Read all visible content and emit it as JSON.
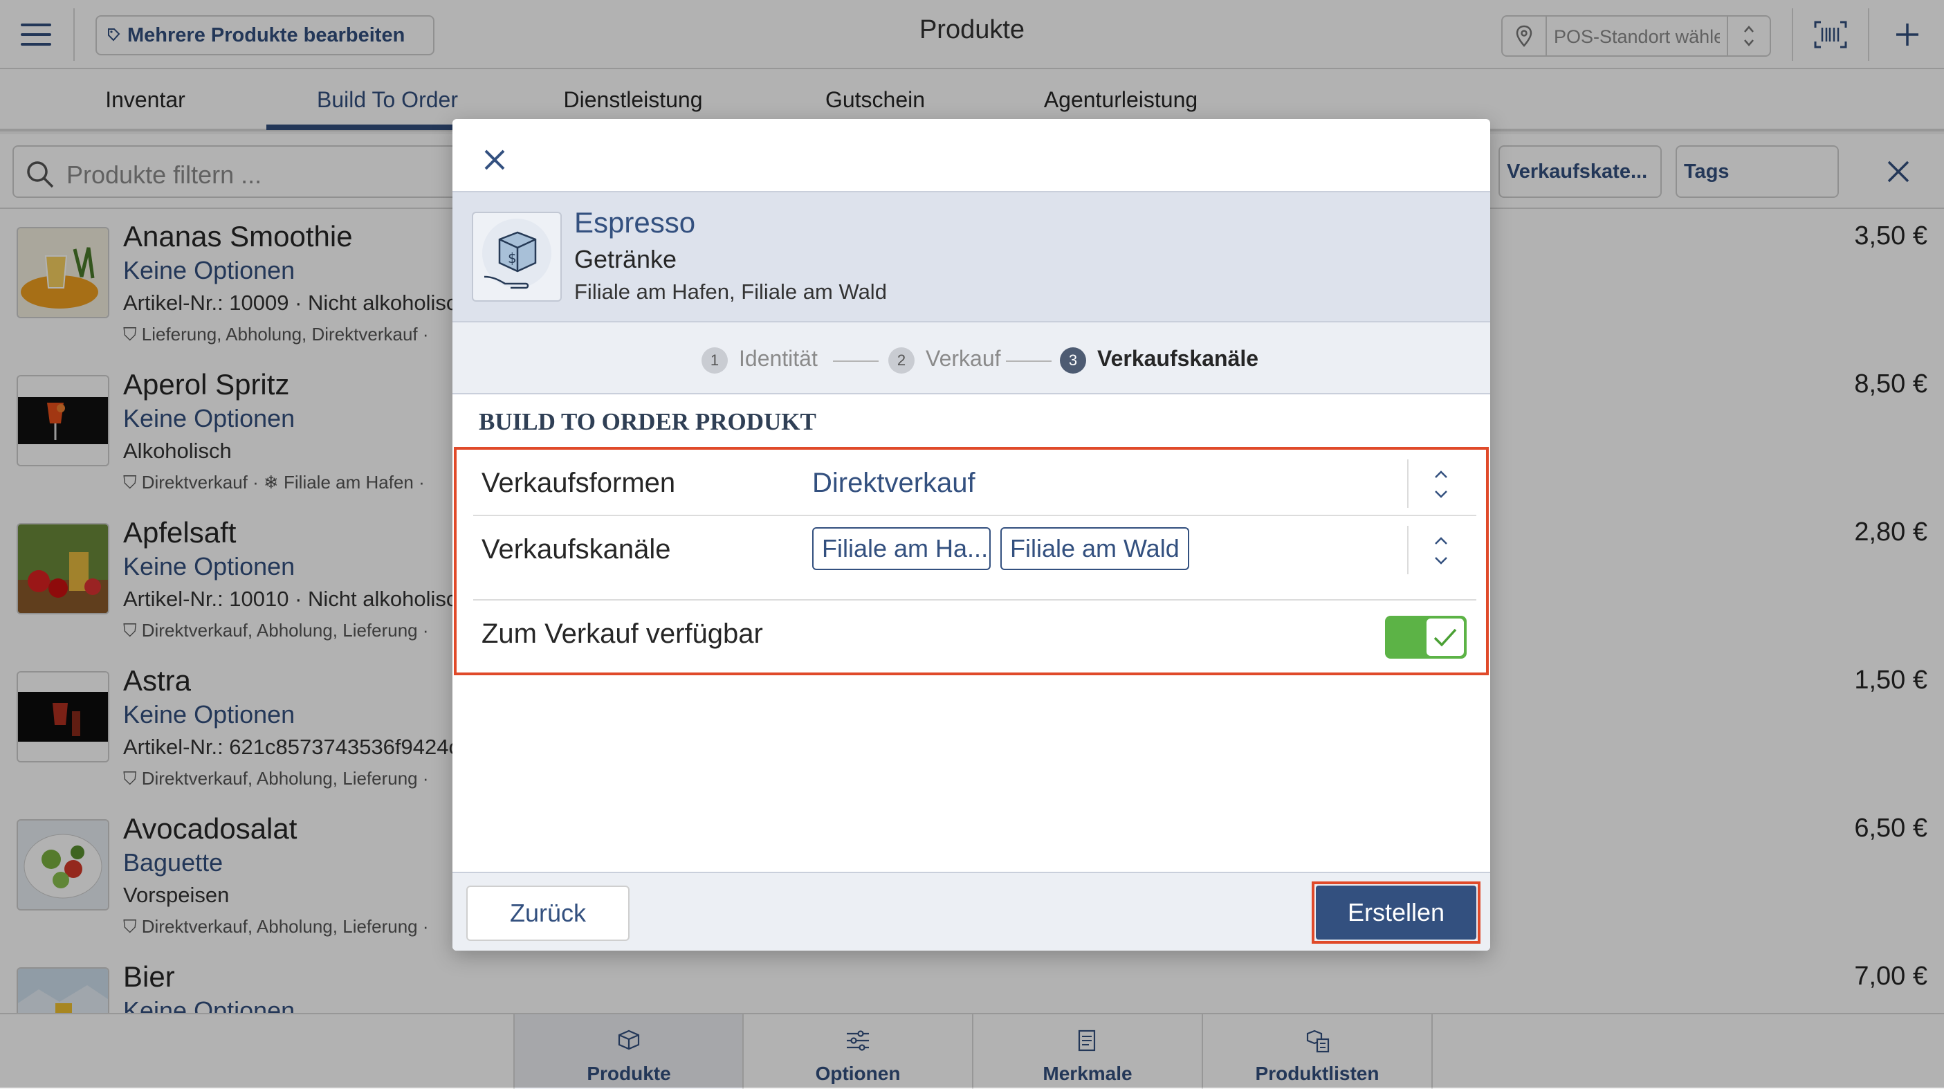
{
  "topbar": {
    "multi_edit_label": "Mehrere Produkte bearbeiten",
    "title": "Produkte",
    "pos_placeholder": "POS-Standort wählen..."
  },
  "tabs": [
    {
      "label": "Inventar"
    },
    {
      "label": "Build To Order",
      "active": true
    },
    {
      "label": "Dienstleistung"
    },
    {
      "label": "Gutschein"
    },
    {
      "label": "Agenturleistung"
    }
  ],
  "filter": {
    "placeholder": "Produkte filtern ...",
    "category_label": "Verkaufskate...",
    "tags_label": "Tags"
  },
  "products": [
    {
      "name": "Ananas Smoothie",
      "options": "Keine Optionen",
      "info": "Artikel-Nr.: 10009 · Nicht alkoholisc",
      "tags": "Lieferung, Abholung, Direktverkauf · ",
      "price": "3,50 €"
    },
    {
      "name": "Aperol Spritz",
      "options": "Keine Optionen",
      "info": "Alkoholisch",
      "tags": "Direktverkauf · ❄ Filiale am Hafen · ",
      "price": "8,50 €"
    },
    {
      "name": "Apfelsaft",
      "options": "Keine Optionen",
      "info": "Artikel-Nr.: 10010 · Nicht alkoholisc",
      "tags": "Direktverkauf, Abholung, Lieferung · ",
      "price": "2,80 €"
    },
    {
      "name": "Astra",
      "options": "Keine Optionen",
      "info": "Artikel-Nr.: 621c8573743536f9424c",
      "tags": "Direktverkauf, Abholung, Lieferung · ",
      "price": "1,50 €"
    },
    {
      "name": "Avocadosalat",
      "options": "Baguette",
      "info": "Vorspeisen",
      "tags": "Direktverkauf, Abholung, Lieferung · ",
      "price": "6,50 €"
    },
    {
      "name": "Bier",
      "options": "Keine Optionen",
      "info": "",
      "tags": "",
      "price": "7,00 €"
    }
  ],
  "bottom_nav": [
    {
      "label": "Produkte",
      "active": true
    },
    {
      "label": "Optionen"
    },
    {
      "label": "Merkmale"
    },
    {
      "label": "Produktlisten"
    }
  ],
  "modal": {
    "product_name": "Espresso",
    "category": "Getränke",
    "locations": "Filiale am Hafen, Filiale am Wald",
    "steps": [
      {
        "num": "1",
        "label": "Identität"
      },
      {
        "num": "2",
        "label": "Verkauf"
      },
      {
        "num": "3",
        "label": "Verkaufskanäle",
        "active": true
      }
    ],
    "section_title": "BUILD TO ORDER PRODUKT",
    "sales_forms_label": "Verkaufsformen",
    "sales_forms_value": "Direktverkauf",
    "sales_channels_label": "Verkaufskanäle",
    "sales_channels": [
      "Filiale am Ha...",
      "Filiale am Wald"
    ],
    "available_label": "Zum Verkauf verfügbar",
    "available": true,
    "back_label": "Zurück",
    "create_label": "Erstellen"
  },
  "colors": {
    "brand": "#33507f",
    "highlight": "#e04a2a",
    "toggle_on": "#5cb346"
  }
}
